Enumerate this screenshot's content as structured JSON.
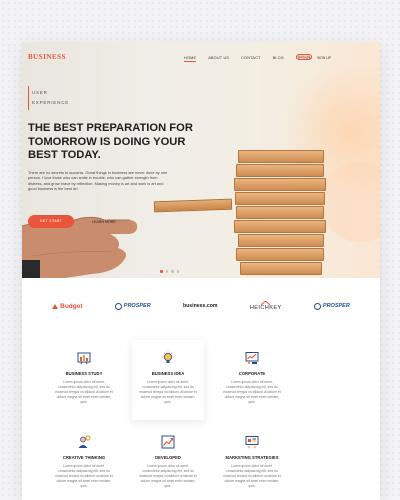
{
  "nav": {
    "logo": "BUSINESS",
    "links": [
      "HOME",
      "ABOUT US",
      "CONTACT",
      "BLOG",
      "OPTION"
    ],
    "signin": "SIGN IN",
    "signup": "SIGN UP"
  },
  "hero": {
    "eyebrow_1": "USER",
    "eyebrow_2": "EXPERIENCE",
    "headline": "THE BEST PREPARATION FOR TOMORROW IS DOING YOUR BEST TODAY.",
    "subcopy": "There are no secrets to success. Great things in business are never done by one person. I love those who can smile in trouble, who can gather strength from distress, and grow brave by reflection. Making money is art and work is art and good business is the best art.",
    "cta_primary": "GET START",
    "cta_secondary": "LEARN MORE",
    "slide_count": 4,
    "active_slide": 1
  },
  "logos": [
    "Budget",
    "PROSPER",
    "business.com",
    "HEICHKEY",
    "PROSPER"
  ],
  "services": [
    {
      "title": "BUSINESS STUDY",
      "text": "Lorem ipsum dolor sit amet, consectetur adipisicing elit, sed do eiusmod tempor incididunt ut labore et dolore magna sit amet enim veniam, quis."
    },
    {
      "title": "BUSINESS IDEA",
      "text": "Lorem ipsum dolor sit amet, consectetur adipisicing elit, sed do eiusmod tempor incididunt ut labore et dolore magna sit amet enim veniam, quis."
    },
    {
      "title": "CORPORATE",
      "text": "Lorem ipsum dolor sit amet, consectetur adipisicing elit, sed do eiusmod tempor incididunt ut labore et dolore magna sit amet enim veniam, quis."
    },
    {
      "title": "CREATIVE THINKING",
      "text": "Lorem ipsum dolor sit amet, consectetur adipisicing elit, sed do eiusmod tempor incididunt ut labore et dolore magna sit amet enim veniam, quis."
    },
    {
      "title": "DEVELOPED",
      "text": "Lorem ipsum dolor sit amet, consectetur adipisicing elit, sed do eiusmod tempor incididunt ut labore et dolore magna sit amet enim veniam, quis."
    },
    {
      "title": "MARKETING STRATEGIES",
      "text": "Lorem ipsum dolor sit amet, consectetur adipisicing elit, sed do eiusmod tempor incididunt ut labore et dolore magna sit amet enim veniam, quis."
    }
  ],
  "colors": {
    "accent": "#e8553a",
    "brand_blue": "#1f4f9e"
  },
  "icons": [
    "chart-board-icon",
    "lightbulb-icon",
    "presentation-icon",
    "person-gear-icon",
    "growth-chart-icon",
    "marketing-board-icon"
  ]
}
